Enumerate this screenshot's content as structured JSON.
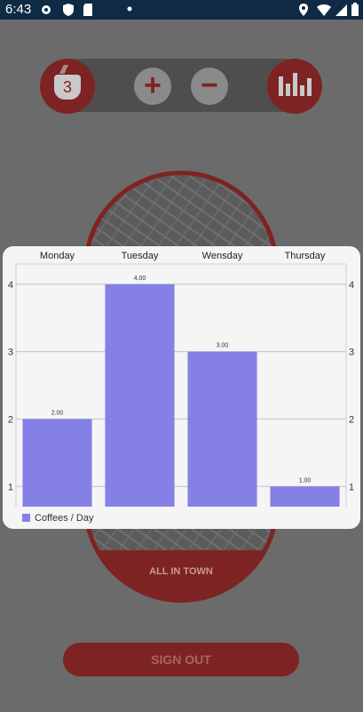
{
  "status_bar": {
    "time": "6:43",
    "icons": [
      "gear-icon",
      "shield-icon",
      "sd-card-icon",
      "dot-icon",
      "location-icon",
      "wifi-icon",
      "signal-icon",
      "battery-icon"
    ]
  },
  "app": {
    "cup_count": "3",
    "map_label": "ALL IN TOWN",
    "sign_out_label": "SIGN OUT",
    "accent": "#7e2323"
  },
  "chart_data": {
    "type": "bar",
    "categories": [
      "Monday",
      "Tuesday",
      "Wensday",
      "Thursday"
    ],
    "values": [
      2,
      4,
      3,
      1
    ],
    "value_labels": [
      "2.00",
      "4.00",
      "3.00",
      "1.00"
    ],
    "y_ticks": [
      "1",
      "2",
      "3",
      "4"
    ],
    "ylim": [
      0.7,
      4.3
    ],
    "series_name": "Coffees / Day",
    "bar_color": "#8480e6",
    "legend_position": "bottom-left",
    "grid": true,
    "axis_labels_position": "top"
  }
}
